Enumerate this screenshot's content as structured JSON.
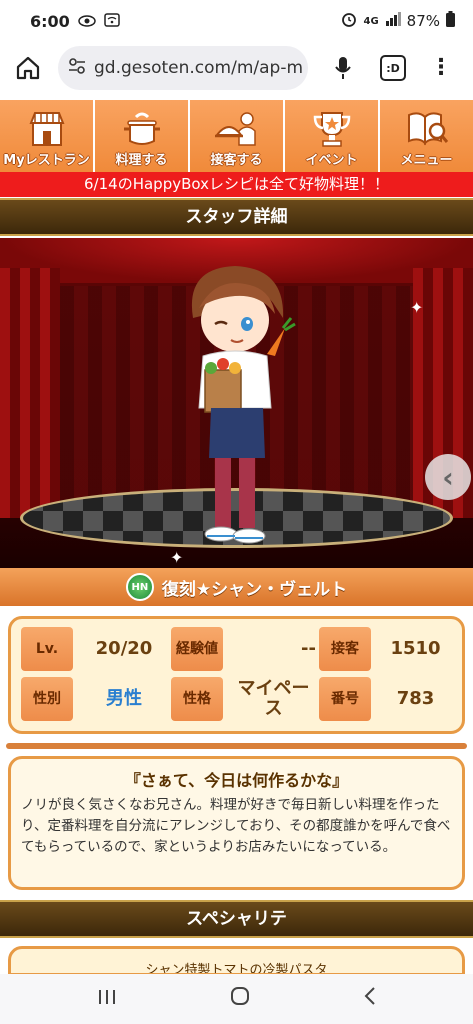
{
  "status_bar": {
    "time": "6:00",
    "network": "4G",
    "battery": "87%"
  },
  "browser": {
    "url": "gd.gesoten.com/m/ap-m",
    "tabs_label": ":D"
  },
  "menu": [
    {
      "label": "Myレストラン",
      "icon": "restaurant-icon"
    },
    {
      "label": "料理する",
      "icon": "pot-icon"
    },
    {
      "label": "接客する",
      "icon": "waiter-icon"
    },
    {
      "label": "イベント",
      "icon": "trophy-icon"
    },
    {
      "label": "メニュー",
      "icon": "book-icon"
    }
  ],
  "notice": "6/14のHappyBoxレシピは全て好物料理！！",
  "section_title": "スタッフ詳細",
  "staff": {
    "badge": "HN",
    "name": "復刻★シャン・ヴェルト"
  },
  "stats": {
    "lv_label": "Lv.",
    "lv_value": "20/20",
    "exp_label": "経験値",
    "exp_value": "--",
    "service_label": "接客",
    "service_value": "1510",
    "gender_label": "性別",
    "gender_value": "男性",
    "personality_label": "性格",
    "personality_value": "マイペース",
    "number_label": "番号",
    "number_value": "783"
  },
  "quote": {
    "title": "『さぁて、今日は何作るかな』",
    "body": "ノリが良く気さくなお兄さん。料理が好きで毎日新しい料理を作ったり、定番料理を自分流にアレンジしており、その都度誰かを呼んで食べてもらっているので、家というよりお店みたいになっている。"
  },
  "specialty": {
    "title": "スペシャリテ",
    "preview": "シャン特製トマトの冷製パスタ"
  },
  "colors": {
    "menu_orange": "#f08a3a",
    "notice_red": "#ee1c1c",
    "gender_blue": "#2a7fd0"
  }
}
